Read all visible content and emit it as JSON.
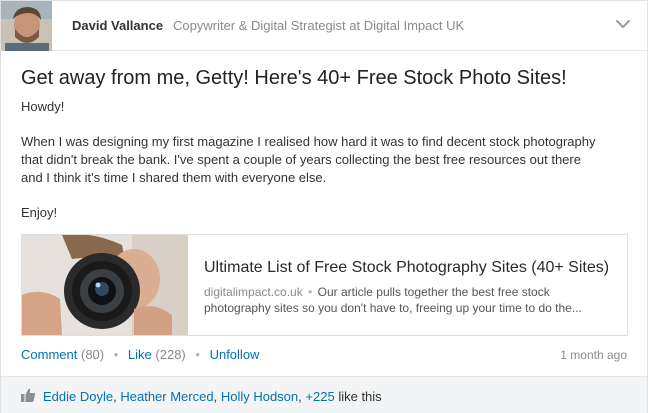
{
  "colors": {
    "link": "#0073b1",
    "muted": "#8a8a8a",
    "likes_bar_bg": "#f3f4f5"
  },
  "author": {
    "name": "David Vallance",
    "headline": "Copywriter & Digital Strategist at Digital Impact UK",
    "menu_icon": "chevron-down-icon"
  },
  "post": {
    "title": "Get away from me, Getty! Here's 40+ Free Stock Photo Sites!",
    "paragraphs": [
      "Howdy!",
      "When I was designing my first magazine I realised how hard it was to find decent stock photography",
      "that didn't break the bank. I've spent a couple of years collecting the best free resources out there",
      "and I think it's time I shared them with everyone else.",
      "Enjoy!"
    ]
  },
  "link_preview": {
    "title": "Ultimate List of Free Stock Photography Sites (40+ Sites)",
    "domain": "digitalimpact.co.uk",
    "separator": "•",
    "description": "Our article pulls together the best free stock photography sites so you don't have to, freeing up your time to do the..."
  },
  "actions": {
    "comment_label": "Comment",
    "comment_count": "(80)",
    "like_label": "Like",
    "like_count": "(228)",
    "unfollow_label": "Unfollow",
    "separator": "•",
    "timestamp": "1 month ago"
  },
  "likes": {
    "icon": "thumbs-up-icon",
    "people": [
      "Eddie Doyle",
      "Heather Merced",
      "Holly Hodson"
    ],
    "others": "+225",
    "comma": ",",
    "suffix": "like this"
  }
}
